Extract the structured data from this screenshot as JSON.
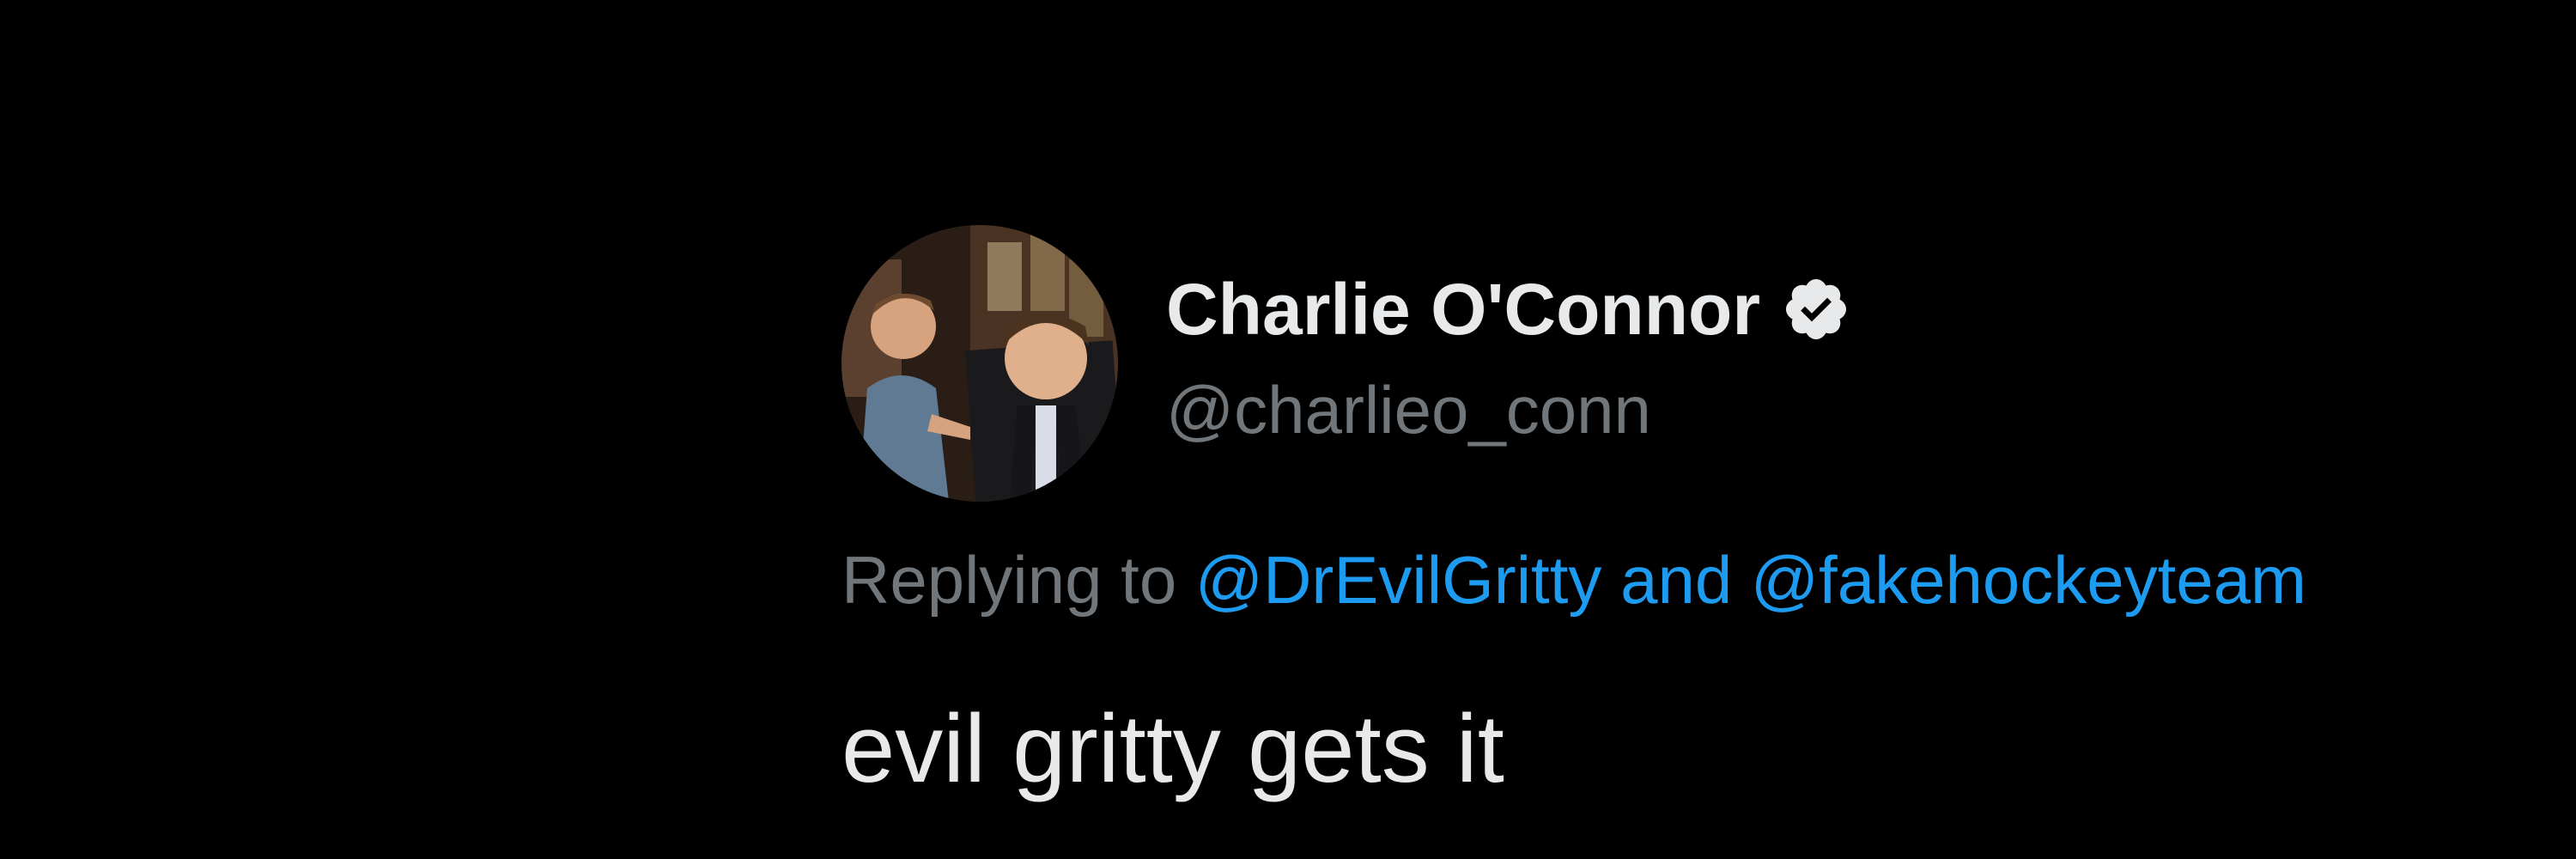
{
  "tweet": {
    "author": {
      "display_name": "Charlie O'Connor",
      "handle": "@charlieo_conn",
      "verified": true,
      "avatar_icon": "profile-photo"
    },
    "reply": {
      "prefix": "Replying to",
      "mentions": [
        "@DrEvilGritty",
        "@fakehockeyteam"
      ],
      "conjunction": "and"
    },
    "text": "evil gritty gets it"
  },
  "colors": {
    "background": "#000000",
    "primary_text": "#e7e9ea",
    "secondary_text": "#71767b",
    "link": "#1d9bf0"
  }
}
